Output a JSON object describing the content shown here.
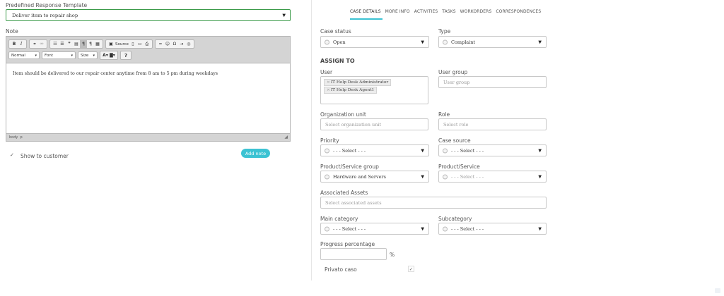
{
  "left": {
    "template_label": "Predefined Response Template",
    "template_value": "Deliver item to repair shop",
    "note_label": "Note",
    "toolbar": {
      "source_label": "Source",
      "format_label": "Normal",
      "font_label": "Font",
      "size_label": "Size",
      "help_label": "?"
    },
    "note_text": "Item should be delivered to our repair center anytime from 8 am to 5 pm during weekdays",
    "statusbar": "body  p",
    "show_customer_label": "Show to customer",
    "show_customer_checked": true,
    "add_note_label": "Add note"
  },
  "tabs": [
    {
      "label": "CASE DETAILS",
      "active": true
    },
    {
      "label": "MORE INFO",
      "active": false
    },
    {
      "label": "ACTIVITIES",
      "active": false
    },
    {
      "label": "TASKS",
      "active": false
    },
    {
      "label": "WORKORDERS",
      "active": false
    },
    {
      "label": "CORRESPONDENCES",
      "active": false
    }
  ],
  "form": {
    "case_status_label": "Case status",
    "case_status_value": "Open",
    "type_label": "Type",
    "type_value": "Complaint",
    "assign_to_heading": "ASSIGN TO",
    "user_label": "User",
    "users": [
      "IT Help Desk Administrator",
      "IT Help Desk Agent1"
    ],
    "chip_remove_glyph": "×",
    "user_group_label": "User group",
    "user_group_placeholder": "User group",
    "org_unit_label": "Organization unit",
    "org_unit_placeholder": "Select organization unit",
    "role_label": "Role",
    "role_placeholder": "Select role",
    "priority_label": "Priority",
    "priority_value": "- - - Select - - -",
    "case_source_label": "Case source",
    "case_source_value": "- - - Select - - -",
    "product_group_label": "Product/Service group",
    "product_group_value": "Hardware and Servers",
    "product_label": "Product/Service",
    "product_value": "- - - Select - - -",
    "assets_label": "Associated Assets",
    "assets_placeholder": "Select associated assets",
    "main_category_label": "Main category",
    "main_category_value": "- - - Select - - -",
    "subcategory_label": "Subcategory",
    "subcategory_value": "- - - Select - - -",
    "progress_label": "Progress percentage",
    "progress_value": "",
    "progress_unit": "%",
    "private_label": "Privato caso",
    "private_checked": true
  },
  "colors": {
    "accent": "#3cc3d3",
    "template_border": "#3c9b4a",
    "toolbar_bg": "#d4d4d4"
  }
}
